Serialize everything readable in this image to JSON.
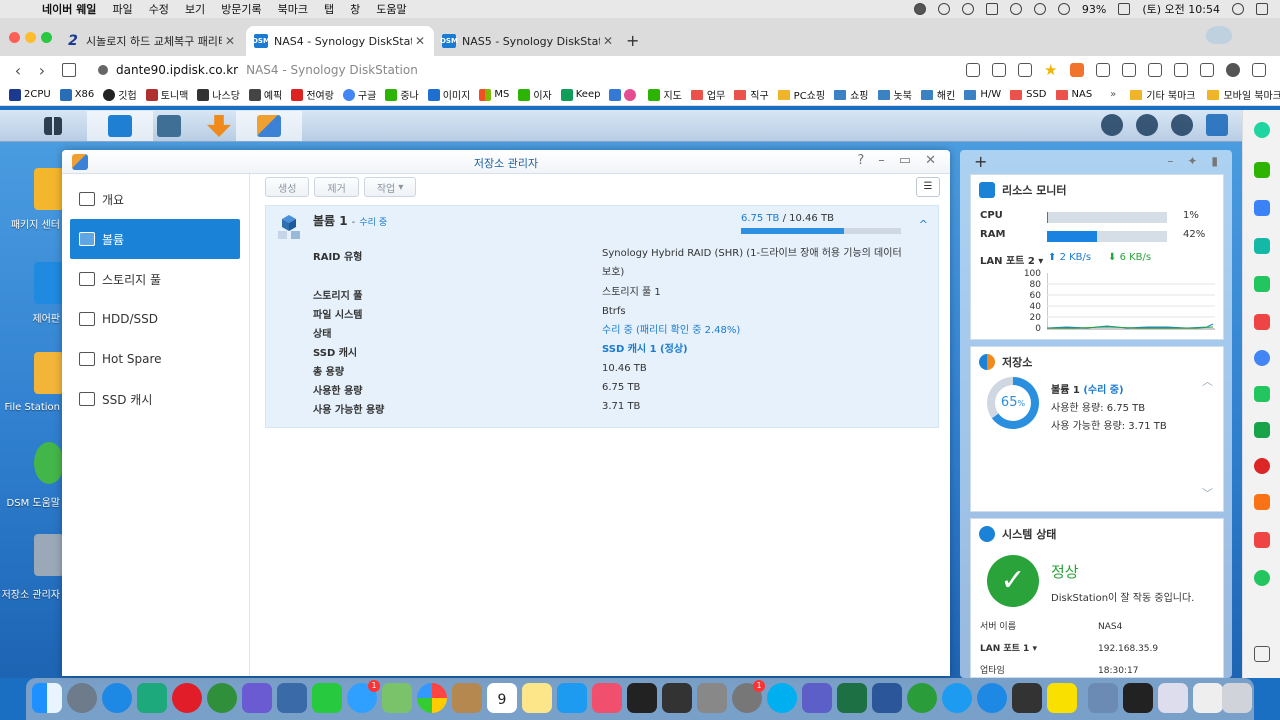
{
  "menubar": {
    "apple": "",
    "items": [
      "네이버 웨일",
      "파일",
      "수정",
      "보기",
      "방문기록",
      "북마크",
      "탭",
      "창",
      "도움말"
    ],
    "battery": "93%",
    "clock": "(토) 오전 10:54"
  },
  "tabs": [
    {
      "favicon": "2",
      "title": "시놀로지 하드 교체복구 패리티 검사"
    },
    {
      "favicon": "DSM",
      "title": "NAS4 - Synology DiskStation"
    },
    {
      "favicon": "DSM",
      "title": "NAS5 - Synology DiskStation"
    }
  ],
  "newtab": "+",
  "address": {
    "host": "dante90.ipdisk.co.kr",
    "title": "NAS4 - Synology DiskStation"
  },
  "bookmarks": [
    "2CPU",
    "X86",
    "깃헙",
    "토니맥",
    "나스당",
    "예픽",
    "전여랑",
    "구글",
    "중나",
    "이미지",
    "MS",
    "이자",
    "Keep",
    "지도",
    "업무",
    "직구",
    "PC쇼핑",
    "쇼핑",
    "놋북",
    "해킨",
    "H/W",
    "SSD",
    "NAS"
  ],
  "bookmarks_more": "»",
  "bookmarks_folders": [
    "기타 북마크",
    "모바일 북마크"
  ],
  "desktop_icons": [
    "패키지 센터",
    "제어판",
    "File Station",
    "DSM 도움말",
    "저장소 관리자"
  ],
  "window": {
    "title": "저장소 관리자",
    "sidebar": [
      "개요",
      "볼륨",
      "스토리지 풀",
      "HDD/SSD",
      "Hot Spare",
      "SSD 캐시"
    ],
    "toolbar": {
      "create": "생성",
      "remove": "제거",
      "action": "작업"
    },
    "volume": {
      "name": "볼륨 1",
      "dash": "-",
      "status": "수리 중",
      "used": "6.75 TB",
      "sep": " / ",
      "total": "10.46 TB",
      "usage_fraction": 0.645,
      "collapse": "^",
      "properties": [
        {
          "label": "RAID 유형",
          "value": "Synology Hybrid RAID (SHR) (1-드라이브 장애 허용 기능의 데이터 보호)"
        },
        {
          "label": "스토리지 풀",
          "value": "스토리지 풀 1"
        },
        {
          "label": "파일 시스템",
          "value": "Btrfs"
        },
        {
          "label": "상태",
          "value": "수리 중 (패리티 확인 중 2.48%)"
        },
        {
          "label": "SSD 캐시",
          "value": "SSD 캐시 1 (정상)"
        },
        {
          "label": "총 용량",
          "value": "10.46 TB"
        },
        {
          "label": "사용한 용량",
          "value": "6.75 TB"
        },
        {
          "label": "사용 가능한 용량",
          "value": "3.71 TB"
        }
      ]
    }
  },
  "widgets": {
    "plus": "+",
    "resource": {
      "title": "리소스 모니터",
      "cpu_label": "CPU",
      "cpu_pct": "1%",
      "cpu_fraction": 0.01,
      "ram_label": "RAM",
      "ram_pct": "42%",
      "ram_fraction": 0.42,
      "lan_label": "LAN 포트 2",
      "lan_up": "2 KB/s",
      "lan_down": "6 KB/s",
      "graph_ticks": [
        "100",
        "80",
        "60",
        "40",
        "20",
        "0"
      ]
    },
    "storage": {
      "title": "저장소",
      "percent": "65",
      "percent_unit": "%",
      "fraction": 0.65,
      "volume_name": "볼륨 1",
      "volume_status": "(수리 중)",
      "used_line": "사용한 용량: 6.75 TB",
      "avail_line": "사용 가능한 용량: 3.71 TB"
    },
    "system": {
      "title": "시스템 상태",
      "status": "정상",
      "message": "DiskStation이 잘 작동 중입니다.",
      "rows": [
        {
          "key": "서버 이름",
          "value": "NAS4"
        },
        {
          "key": "LAN 포트 1",
          "value": "192.168.35.9"
        },
        {
          "key": "업타임",
          "value": "18:30:17"
        }
      ]
    }
  },
  "dock_calendar_day": "9",
  "colors": {
    "accent": "#1a82d7",
    "success": "#2aa33a",
    "desktop": "#2f7fcf"
  }
}
